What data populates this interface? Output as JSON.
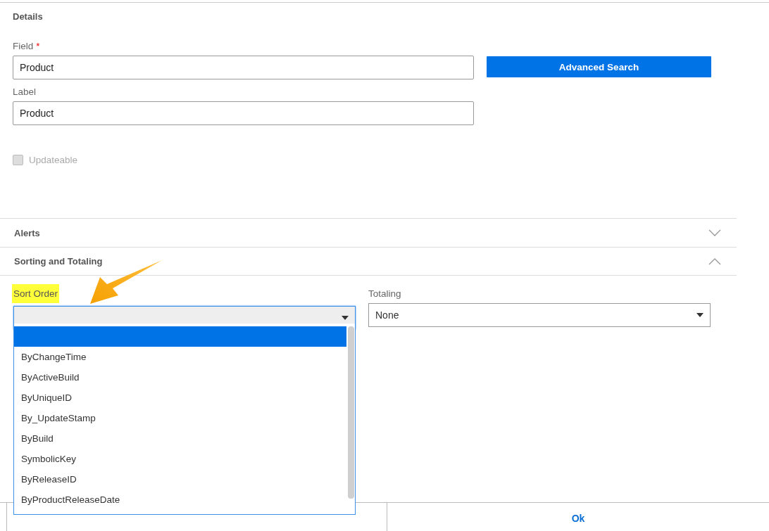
{
  "details": {
    "title": "Details",
    "field": {
      "label": "Field",
      "required_mark": "*",
      "value": "Product"
    },
    "advanced_search_button": "Advanced Search",
    "label_field": {
      "label": "Label",
      "value": "Product"
    },
    "updateable": {
      "label": "Updateable",
      "checked": false,
      "disabled": true
    }
  },
  "sections": [
    {
      "title": "Alerts",
      "expanded": false
    },
    {
      "title": "Sorting and Totaling",
      "expanded": true
    }
  ],
  "sort_order": {
    "label": "Sort Order",
    "highlighted": true,
    "open": true,
    "options": [
      {
        "selected": true
      },
      {
        "label": "ByChangeTime",
        "selected": false
      },
      {
        "label": "ByActiveBuild",
        "selected": false
      },
      {
        "label": "ByUniqueID",
        "selected": false
      },
      {
        "label": "By_UpdateStamp",
        "selected": false
      },
      {
        "label": "ByBuild",
        "selected": false
      },
      {
        "label": "SymbolicKey",
        "selected": false
      },
      {
        "label": "ByReleaseID",
        "selected": false
      },
      {
        "label": "ByProductReleaseDate",
        "selected": false
      }
    ]
  },
  "totaling": {
    "label": "Totaling",
    "value": "None"
  },
  "footer": {
    "ok_button": "Ok"
  }
}
